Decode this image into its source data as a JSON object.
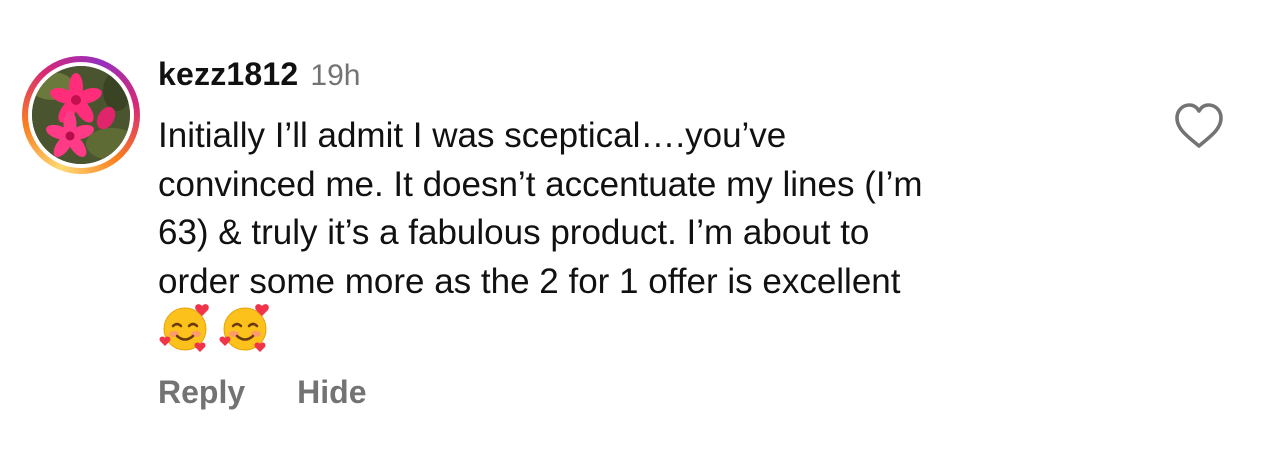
{
  "comment": {
    "username": "kezz1812",
    "timestamp": "19h",
    "text_lines": [
      "Initially I’ll admit I was sceptical….you’ve",
      "convinced me. It doesn’t accentuate my lines (I’m",
      "63) & truly it’s a fabulous product. I’m about to",
      "order some more as the 2 for 1 offer is excellent"
    ],
    "emojis": [
      "smiling-face-with-hearts-icon",
      "smiling-face-with-hearts-icon"
    ],
    "avatar_icon": "pink-flower-photo",
    "story_ring_colors": [
      "#feda75",
      "#fa7e1e",
      "#d62976",
      "#962fbf"
    ],
    "like_icon": "heart-outline-icon"
  },
  "actions": {
    "reply_label": "Reply",
    "hide_label": "Hide"
  },
  "colors": {
    "text": "#111111",
    "muted": "#737373",
    "background": "#ffffff"
  }
}
